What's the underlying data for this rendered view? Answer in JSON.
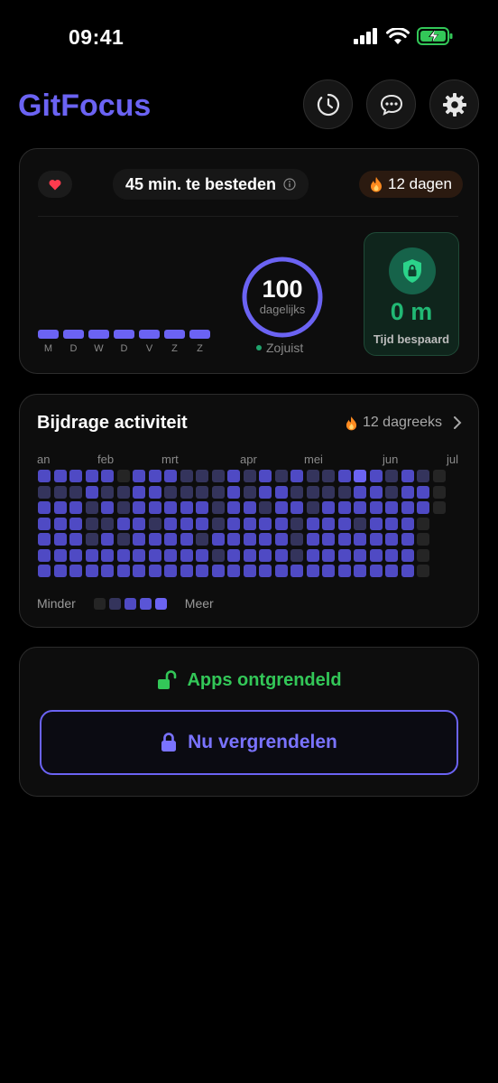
{
  "status": {
    "time": "09:41"
  },
  "app": {
    "title": "GitFocus"
  },
  "header": {
    "icons": [
      "timer-icon",
      "chat-icon",
      "gear-icon"
    ]
  },
  "summary": {
    "time_remaining": "45 min. te besteden",
    "streak": "12 dagen",
    "week_days": [
      "M",
      "D",
      "W",
      "D",
      "V",
      "Z",
      "Z"
    ],
    "score": "100",
    "score_label": "dagelijks",
    "score_status": "Zojuist",
    "saved_value": "0 m",
    "saved_label": "Tijd bespaard"
  },
  "activity": {
    "title": "Bijdrage activiteit",
    "streak": "12 dagreeks",
    "months": [
      "an",
      "feb",
      "mrt",
      "apr",
      "mei",
      "jun",
      "jul"
    ],
    "legend_less": "Minder",
    "legend_more": "Meer",
    "levels": [
      [
        2,
        2,
        2,
        2,
        2,
        0,
        2,
        2,
        2,
        1,
        1,
        1,
        2,
        1,
        2,
        1,
        2,
        1,
        1,
        2,
        3,
        2,
        1,
        2,
        1,
        0
      ],
      [
        1,
        1,
        1,
        2,
        1,
        1,
        2,
        2,
        1,
        1,
        1,
        1,
        2,
        1,
        2,
        2,
        1,
        1,
        1,
        1,
        2,
        2,
        1,
        2,
        2,
        0
      ],
      [
        2,
        2,
        2,
        1,
        2,
        1,
        2,
        2,
        2,
        2,
        2,
        1,
        2,
        2,
        1,
        2,
        2,
        1,
        2,
        2,
        2,
        2,
        2,
        2,
        2,
        0
      ],
      [
        2,
        2,
        2,
        1,
        1,
        2,
        2,
        1,
        2,
        2,
        2,
        1,
        2,
        2,
        2,
        2,
        1,
        2,
        2,
        2,
        1,
        2,
        2,
        2,
        0,
        -1
      ],
      [
        2,
        2,
        2,
        1,
        2,
        1,
        2,
        2,
        2,
        2,
        1,
        2,
        2,
        2,
        2,
        2,
        1,
        2,
        2,
        2,
        2,
        2,
        2,
        2,
        0,
        -1
      ],
      [
        2,
        2,
        2,
        2,
        2,
        2,
        2,
        2,
        2,
        2,
        2,
        1,
        2,
        2,
        2,
        2,
        1,
        2,
        2,
        2,
        2,
        2,
        2,
        2,
        0,
        -1
      ],
      [
        2,
        2,
        2,
        2,
        2,
        2,
        2,
        2,
        2,
        2,
        2,
        2,
        2,
        2,
        2,
        2,
        2,
        2,
        2,
        2,
        2,
        2,
        2,
        2,
        0,
        -1
      ]
    ],
    "colors": [
      "#252525",
      "#34345c",
      "#4f4ac4",
      "#6b63f3"
    ]
  },
  "lock": {
    "status": "Apps ontgrendeld",
    "button": "Nu vergrendelen"
  },
  "colors": {
    "accent": "#6b63f3",
    "green": "#33c758",
    "orange": "#ff9f0a"
  }
}
